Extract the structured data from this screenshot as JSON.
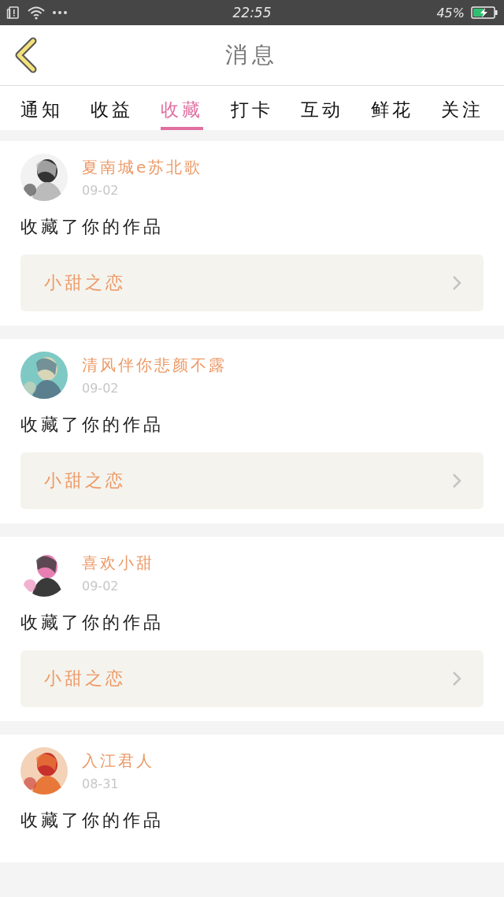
{
  "status_bar": {
    "time": "22:55",
    "battery_percent": "45%"
  },
  "header": {
    "title": "消息"
  },
  "tabs": [
    {
      "label": "通知",
      "selected": false
    },
    {
      "label": "收益",
      "selected": false
    },
    {
      "label": "收藏",
      "selected": true
    },
    {
      "label": "打卡",
      "selected": false
    },
    {
      "label": "互动",
      "selected": false
    },
    {
      "label": "鲜花",
      "selected": false
    },
    {
      "label": "关注",
      "selected": false
    }
  ],
  "messages": [
    {
      "user": "夏南城e苏北歌",
      "date": "09-02",
      "action": "收藏了你的作品",
      "work": "小甜之恋"
    },
    {
      "user": "清风伴你悲颜不露",
      "date": "09-02",
      "action": "收藏了你的作品",
      "work": "小甜之恋"
    },
    {
      "user": "喜欢小甜",
      "date": "09-02",
      "action": "收藏了你的作品",
      "work": "小甜之恋"
    },
    {
      "user": "入江君人",
      "date": "08-31",
      "action": "收藏了你的作品"
    }
  ]
}
